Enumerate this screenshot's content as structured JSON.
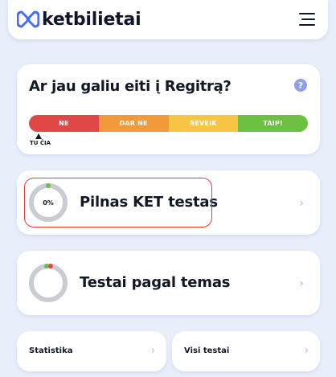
{
  "header": {
    "logo_text": "ketbilietai",
    "logo_icon": "infinity-b-logo",
    "menu_icon": "hamburger-menu-icon"
  },
  "readiness": {
    "title": "Ar jau galiu eiti į Regitrą?",
    "help_icon_glyph": "?",
    "scale": [
      "NE",
      "DAR NE",
      "BEVEIK",
      "TAIP!"
    ],
    "scale_colors": [
      "#e04848",
      "#f2993a",
      "#f7c443",
      "#6cc142"
    ],
    "marker_label": "TU ČIA"
  },
  "cards": {
    "full_test": {
      "title": "Pilnas KET testas",
      "progress_label": "0%",
      "progress": 0
    },
    "topics": {
      "title": "Testai pagal temas"
    },
    "stats": {
      "title": "Statistika"
    },
    "all_tests": {
      "title": "Visi testai"
    },
    "chevron": "›"
  },
  "colors": {
    "accent": "#8f9eea",
    "logo": "#4a6cf0",
    "highlight": "#e53a3a",
    "background": "#e9eefb"
  }
}
